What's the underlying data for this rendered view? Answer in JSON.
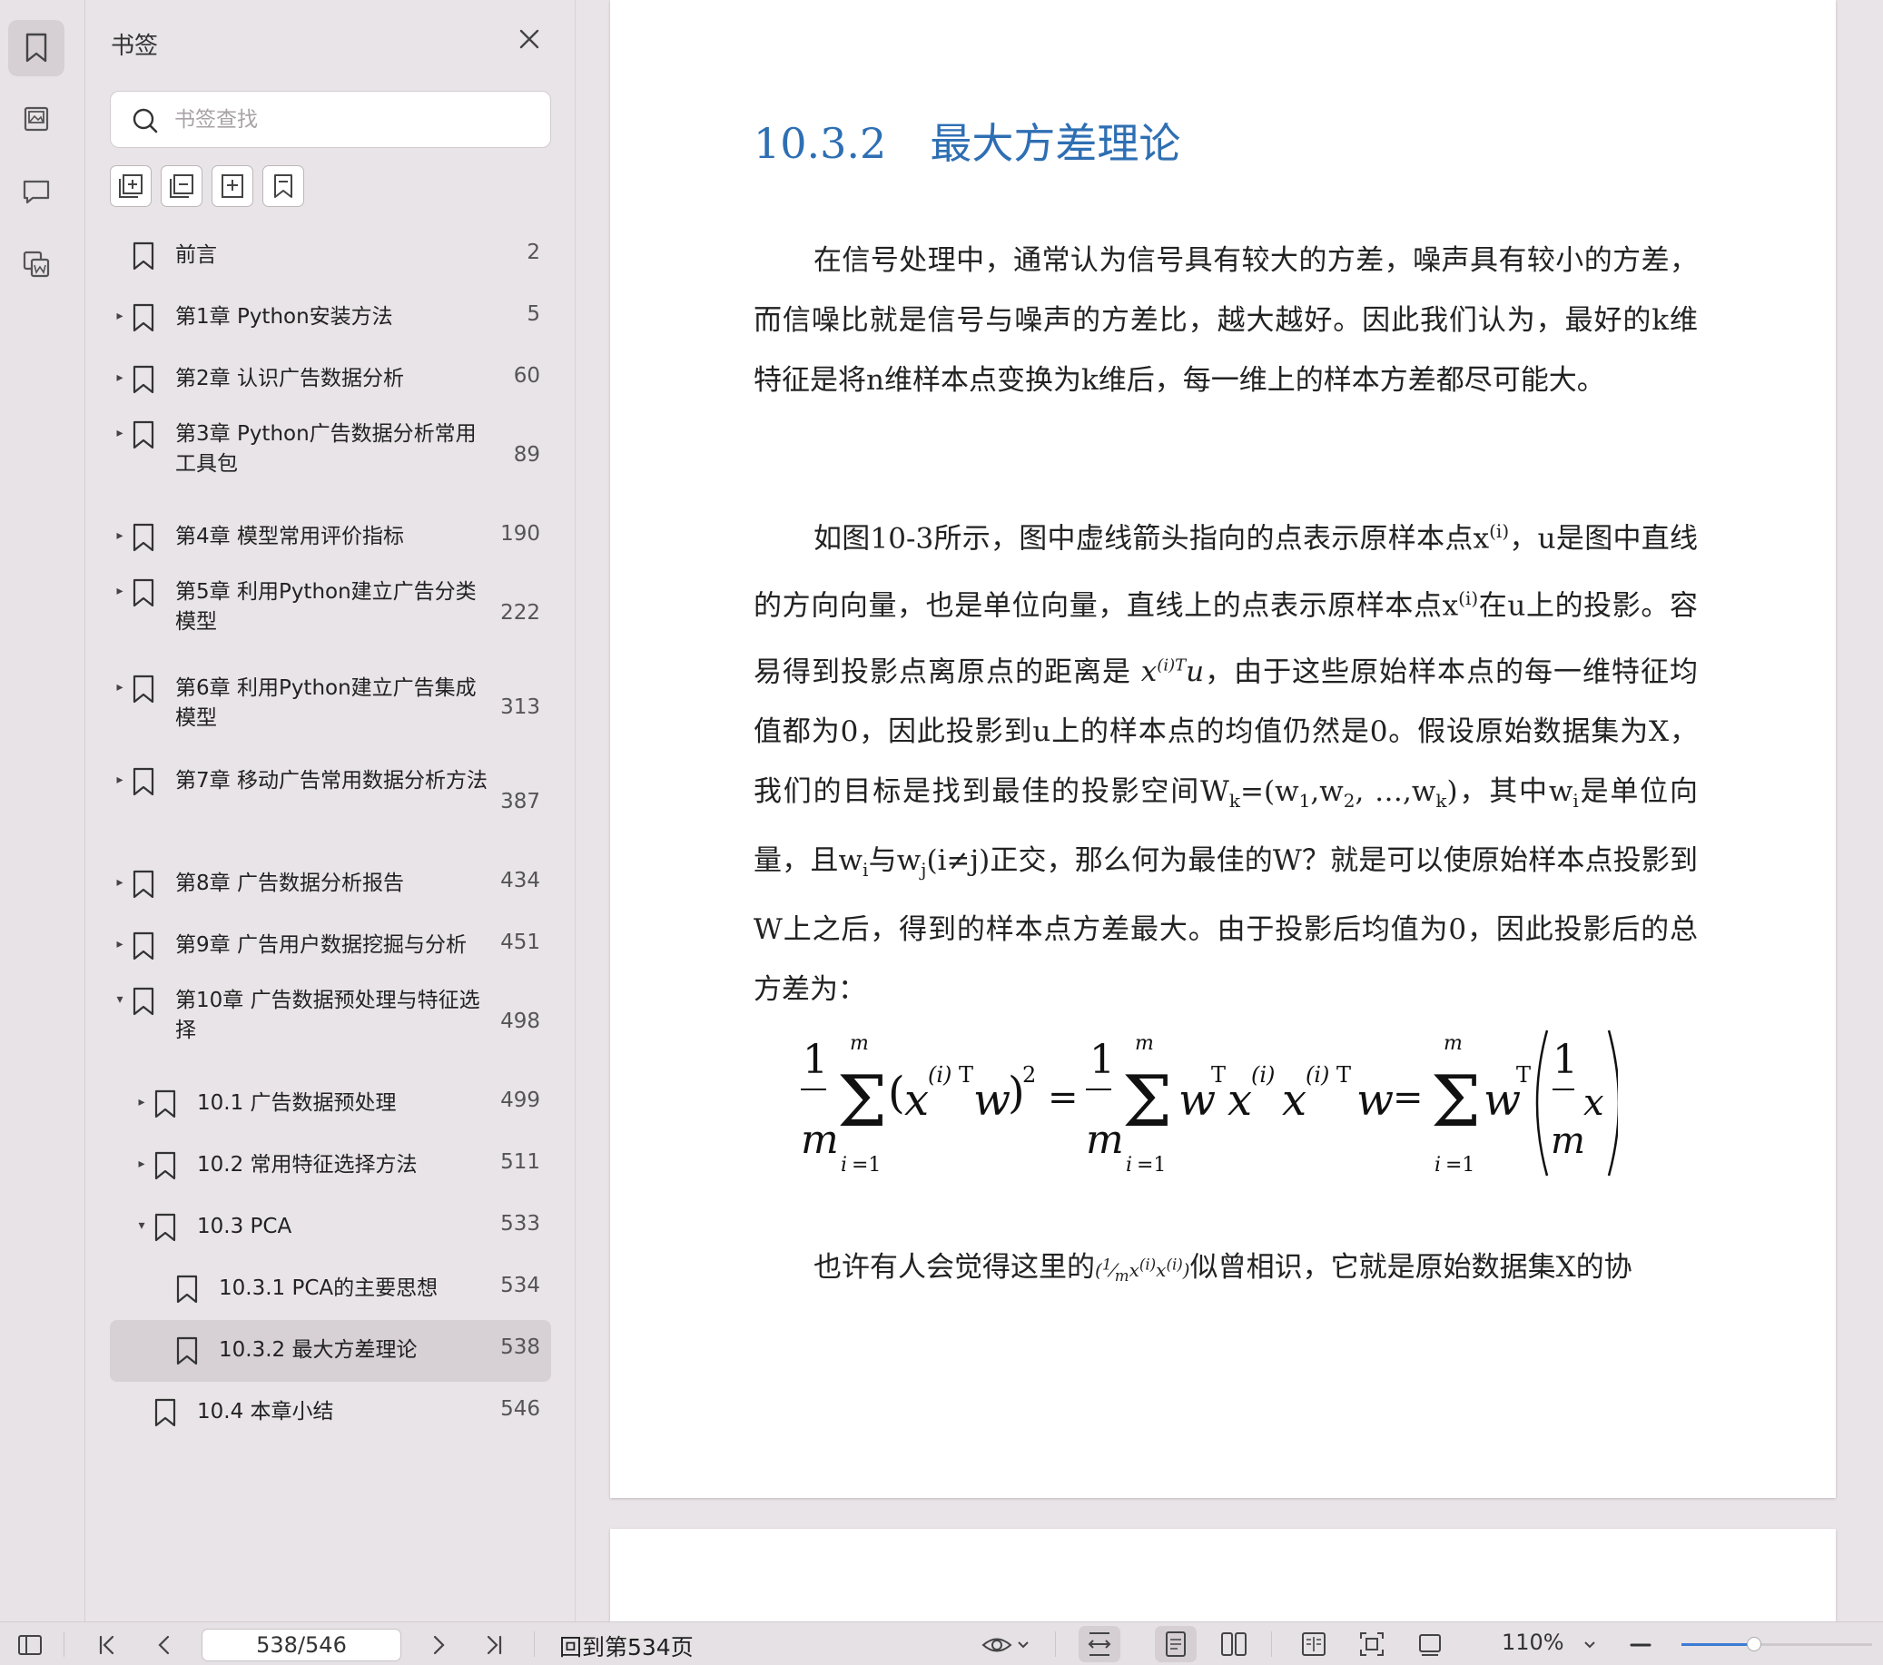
{
  "sidebar": {
    "title": "书签",
    "search_placeholder": "书签查找",
    "bookmarks": [
      {
        "label": "前言",
        "page": "2",
        "level": 0,
        "arrow": ""
      },
      {
        "label": "第1章 Python安装方法",
        "page": "5",
        "level": 0,
        "arrow": "▸"
      },
      {
        "label": "第2章 认识广告数据分析",
        "page": "60",
        "level": 0,
        "arrow": "▸"
      },
      {
        "label": "第3章 Python广告数据分析常用工具包",
        "page": "89",
        "level": 0,
        "arrow": "▸"
      },
      {
        "label": "第4章 模型常用评价指标",
        "page": "190",
        "level": 0,
        "arrow": "▸"
      },
      {
        "label": "第5章 利用Python建立广告分类模型",
        "page": "222",
        "level": 0,
        "arrow": "▸"
      },
      {
        "label": "第6章 利用Python建立广告集成模型",
        "page": "313",
        "level": 0,
        "arrow": "▸"
      },
      {
        "label": "第7章 移动广告常用数据分析方法",
        "page": "387",
        "level": 0,
        "arrow": "▸"
      },
      {
        "label": "第8章 广告数据分析报告",
        "page": "434",
        "level": 0,
        "arrow": "▸"
      },
      {
        "label": "第9章 广告用户数据挖掘与分析",
        "page": "451",
        "level": 0,
        "arrow": "▸"
      },
      {
        "label": "第10章 广告数据预处理与特征选择",
        "page": "498",
        "level": 0,
        "arrow": "▾"
      },
      {
        "label": "10.1 广告数据预处理",
        "page": "499",
        "level": 1,
        "arrow": "▸"
      },
      {
        "label": "10.2 常用特征选择方法",
        "page": "511",
        "level": 1,
        "arrow": "▸"
      },
      {
        "label": "10.3 PCA",
        "page": "533",
        "level": 1,
        "arrow": "▾"
      },
      {
        "label": "10.3.1 PCA的主要思想",
        "page": "534",
        "level": 2,
        "arrow": ""
      },
      {
        "label": "10.3.2 最大方差理论",
        "page": "538",
        "level": 2,
        "arrow": "",
        "selected": true
      },
      {
        "label": "10.4 本章小结",
        "page": "546",
        "level": 1,
        "arrow": ""
      }
    ]
  },
  "document": {
    "heading_number": "10.3.2",
    "heading_title": "最大方差理论",
    "para1": "在信号处理中，通常认为信号具有较大的方差，噪声具有较小的方差，而信噪比就是信号与噪声的方差比，越大越好。因此我们认为，最好的k维特征是将n维样本点变换为k维后，每一维上的样本方差都尽可能大。",
    "para2_a": "如图10-3所示，图中虚线箭头指向的点表示原样本点x",
    "para2_b": "，u是图中直线的方向向量，也是单位向量，直线上的点表示原样本点x",
    "para2_c": "在u上的投影。容易得到投影点离原点的距离是",
    "para2_d": "，由于这些原始样本点的每一维特征均值都为0，因此投影到u上的样本点的均值仍然是0。假设原始数据集为X，我们的目标是找到最佳的投影空间W",
    "para2_e": "=(w",
    "para2_f": ",w",
    "para2_g": ", …,w",
    "para2_h": ")，其中w",
    "para2_i": "是单位向量，且w",
    "para2_j": "与w",
    "para2_k": "(i≠j)正交，那么何为最佳的W？就是可以使原始样本点投影到W上之后，得到的样本点方差最大。由于投影后均值为0，因此投影后的总方差为：",
    "last_a": "也许有人会觉得这里的",
    "last_b": "似曾相识，它就是原始数据集X的协"
  },
  "statusbar": {
    "page_input": "538/546",
    "goto_label": "回到第534页",
    "zoom": "110%",
    "zoom_slider": 0.38
  },
  "colors": {
    "heading": "#2e6fb3",
    "slider": "#3a7bd5"
  }
}
